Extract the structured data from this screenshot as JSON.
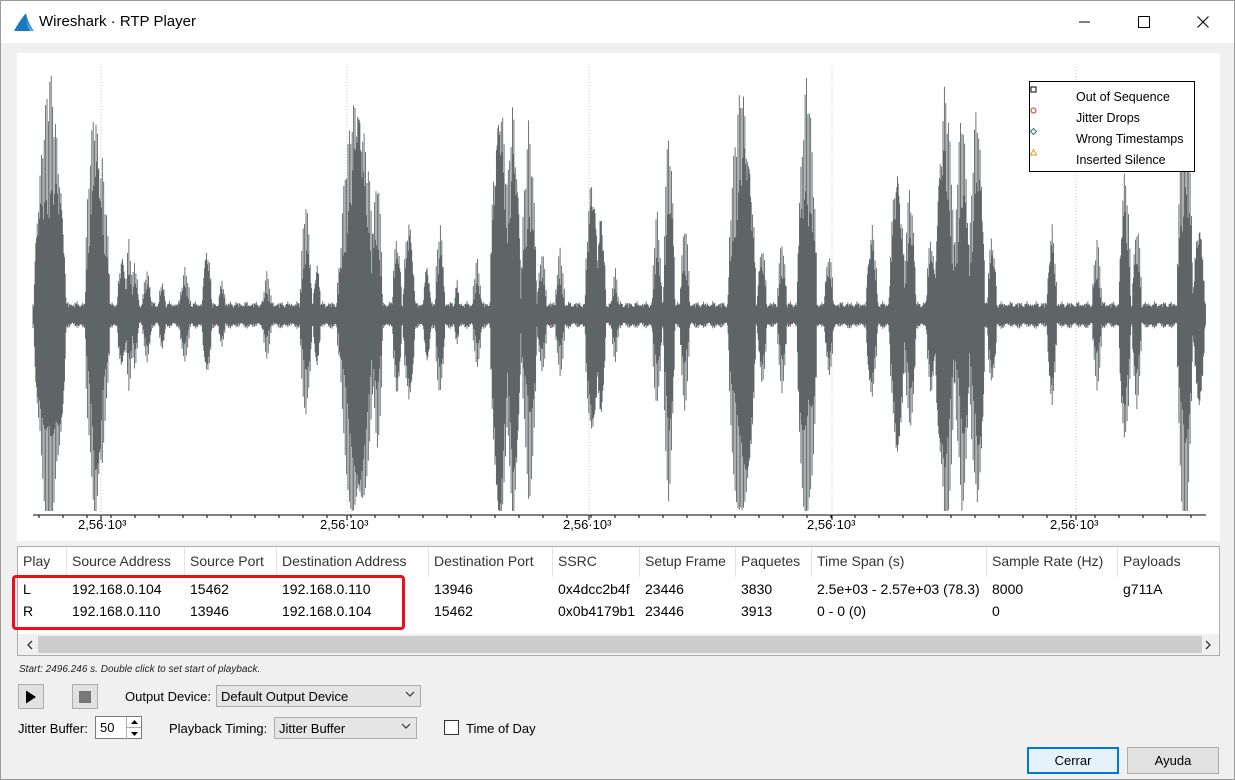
{
  "window": {
    "title": "Wireshark · RTP Player",
    "icon": "wireshark-fin-icon",
    "controls": [
      "minimize-icon",
      "maximize-icon",
      "close-icon"
    ]
  },
  "waveform": {
    "x_tick_labels": [
      "2,56·10³",
      "2,56·10³",
      "2,56·10³",
      "2,56·10³",
      "2,56·10³"
    ],
    "wave_color": "#5f6466",
    "legend": [
      {
        "label": "Out of Sequence",
        "marker": "square",
        "color": "#000000"
      },
      {
        "label": "Jitter Drops",
        "marker": "circle",
        "color": "#d62728"
      },
      {
        "label": "Wrong Timestamps",
        "marker": "diamond",
        "color": "#2a7c6f"
      },
      {
        "label": "Inserted Silence",
        "marker": "triangle",
        "color": "#d6a31e"
      }
    ]
  },
  "table": {
    "columns": [
      "Play",
      "Source Address",
      "Source Port",
      "Destination Address",
      "Destination Port",
      "SSRC",
      "Setup Frame",
      "Paquetes",
      "Time Span (s)",
      "Sample Rate (Hz)",
      "Payloads"
    ],
    "rows": [
      [
        "L",
        "192.168.0.104",
        "15462",
        "192.168.0.110",
        "13946",
        "0x4dcc2b4f",
        "23446",
        "3830",
        "2.5e+03 - 2.57e+03 (78.3)",
        "8000",
        "g711A"
      ],
      [
        "R",
        "192.168.0.110",
        "13946",
        "192.168.0.104",
        "15462",
        "0x0b4179b1",
        "23446",
        "3913",
        "0 - 0 (0)",
        "0",
        ""
      ]
    ],
    "highlight_color": "#e8101a"
  },
  "hint": "Start: 2496.246 s. Double click to set start of playback.",
  "controls": {
    "output_device_label": "Output Device:",
    "output_device_value": "Default Output Device",
    "jitter_buffer_label": "Jitter Buffer:",
    "jitter_buffer_value": "50",
    "playback_timing_label": "Playback Timing:",
    "playback_timing_value": "Jitter Buffer",
    "time_of_day_label": "Time of Day",
    "time_of_day_checked": false
  },
  "buttons": {
    "close_label": "Cerrar",
    "help_label": "Ayuda"
  },
  "accent_color": "#0078d7"
}
